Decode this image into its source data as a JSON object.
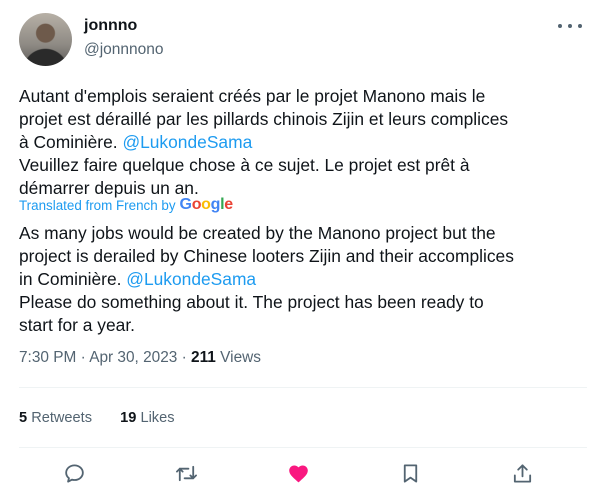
{
  "author": {
    "display_name": "jonnno",
    "handle": "@jonnnono"
  },
  "tweet": {
    "original_lines": [
      "Autant d'emplois seraient créés par le projet Manono mais le",
      "projet est déraillé par les pillards chinois Zijin et leurs complices",
      "à Cominière.",
      "Veuillez faire quelque chose à ce sujet. Le projet est prêt à",
      "démarrer depuis un an."
    ],
    "original_mention": "@LukondeSama",
    "translated_label": "Translated from French by",
    "translator": "Google",
    "translated_lines": [
      "As many jobs would be created by the Manono project but the",
      "project is derailed by Chinese looters Zijin and their accomplices",
      "in Cominière.",
      "Please do something about it. The project has been ready to",
      "start for a year."
    ],
    "translated_mention": "@LukondeSama"
  },
  "meta": {
    "time": "7:30 PM",
    "date": "Apr 30, 2023",
    "separator": "·",
    "views_count": "211",
    "views_label": "Views"
  },
  "stats": {
    "retweets_count": "5",
    "retweets_label": "Retweets",
    "likes_count": "19",
    "likes_label": "Likes"
  },
  "actions": {
    "reply": "reply-icon",
    "retweet": "retweet-icon",
    "like": "heart-icon",
    "bookmark": "bookmark-icon",
    "share": "share-icon",
    "like_color": "#f91880",
    "icon_color": "#536471",
    "link_color": "#1d9bf0"
  }
}
